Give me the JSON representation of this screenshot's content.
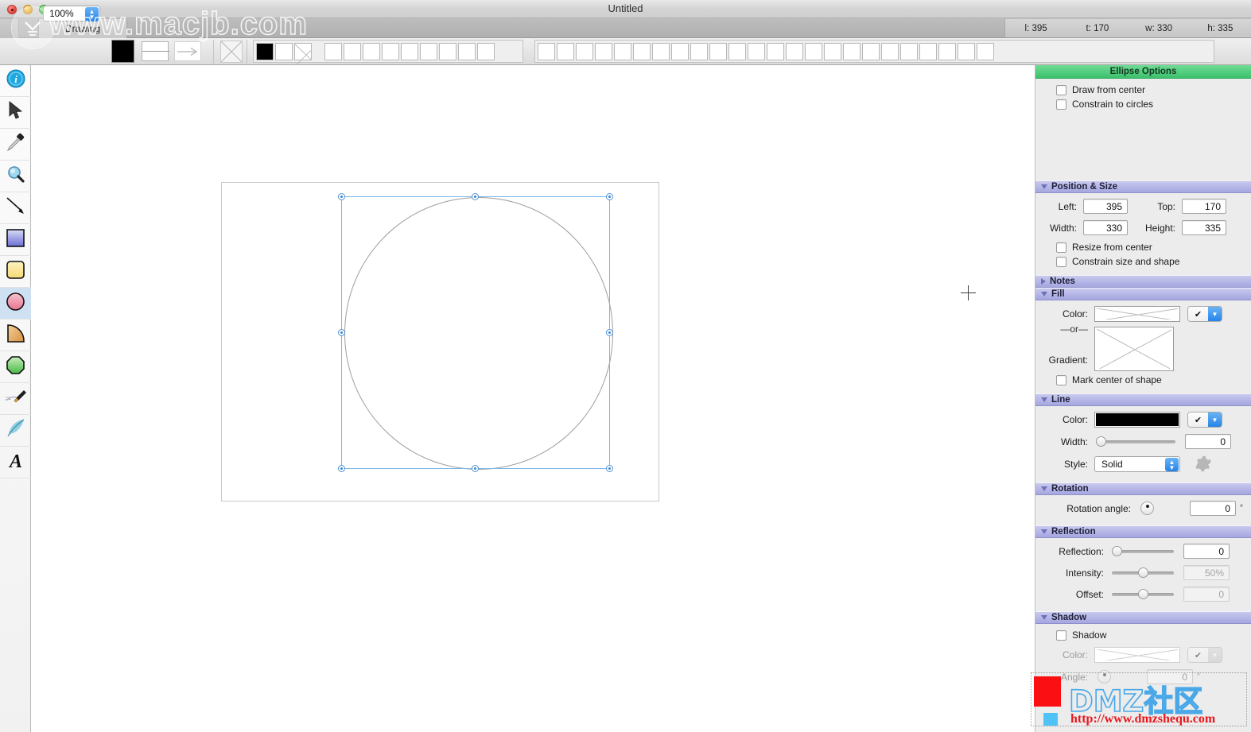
{
  "window": {
    "title": "Untitled",
    "tab_label": "Drawing",
    "traffic_lights": [
      "close-button",
      "minimize-button",
      "zoom-button"
    ]
  },
  "status_bar": {
    "left": "l: 395",
    "top": "t: 170",
    "width": "w: 330",
    "height": "h: 335"
  },
  "toolbar": {
    "zoom_level": "100%",
    "fill_swatch_color": "#000000",
    "line_swatch": "line-style-swatch",
    "arrow_swatch": "arrow-style-swatch",
    "palette_group_1": [
      "black",
      "white",
      "none"
    ],
    "palette_group_1_count": 3,
    "palette_empty_1_count": 9,
    "palette_empty_2_count": 24
  },
  "tools": [
    {
      "name": "info-tool",
      "icon": "info-icon",
      "selected": false
    },
    {
      "name": "selection-tool",
      "icon": "arrow-cursor-icon",
      "selected": false
    },
    {
      "name": "eyedropper-tool",
      "icon": "eyedropper-icon",
      "selected": false
    },
    {
      "name": "zoom-tool",
      "icon": "magnifier-icon",
      "selected": false
    },
    {
      "name": "line-tool",
      "icon": "diagonal-line-icon",
      "selected": false
    },
    {
      "name": "rectangle-tool",
      "icon": "rectangle-icon",
      "selected": false
    },
    {
      "name": "rounded-rectangle-tool",
      "icon": "rounded-rectangle-icon",
      "selected": false
    },
    {
      "name": "ellipse-tool",
      "icon": "ellipse-icon",
      "selected": true
    },
    {
      "name": "arc-tool",
      "icon": "quarter-arc-icon",
      "selected": false
    },
    {
      "name": "polygon-tool",
      "icon": "polygon-icon",
      "selected": false
    },
    {
      "name": "pen-tool",
      "icon": "fountain-pen-icon",
      "selected": false
    },
    {
      "name": "freehand-tool",
      "icon": "feather-quill-icon",
      "selected": false
    },
    {
      "name": "text-tool",
      "icon": "letter-a-icon",
      "selected": false
    }
  ],
  "canvas": {
    "shape": "ellipse",
    "selection_handles": 8,
    "cursor": "crosshair-cursor"
  },
  "inspector": {
    "ellipse_options": {
      "title": "Ellipse Options",
      "draw_from_center": {
        "label": "Draw from center",
        "checked": false
      },
      "constrain_to_circles": {
        "label": "Constrain to circles",
        "checked": false
      }
    },
    "position_size": {
      "title": "Position & Size",
      "expanded": true,
      "left_label": "Left:",
      "left_value": "395",
      "top_label": "Top:",
      "top_value": "170",
      "width_label": "Width:",
      "width_value": "330",
      "height_label": "Height:",
      "height_value": "335",
      "resize_from_center": {
        "label": "Resize from center",
        "checked": false
      },
      "constrain_size_and_shape": {
        "label": "Constrain size and shape",
        "checked": false
      }
    },
    "notes": {
      "title": "Notes",
      "expanded": false
    },
    "fill": {
      "title": "Fill",
      "expanded": true,
      "color_label": "Color:",
      "color_value": "none",
      "or_label": "—or—",
      "gradient_label": "Gradient:",
      "gradient_value": "none",
      "mark_center": {
        "label": "Mark center of shape",
        "checked": false
      },
      "apply_button": "✔"
    },
    "line": {
      "title": "Line",
      "expanded": true,
      "color_label": "Color:",
      "color_value": "#000000",
      "width_label": "Width:",
      "width_value": "0",
      "style_label": "Style:",
      "style_value": "Solid",
      "settings_icon": "gear-icon",
      "apply_button": "✔"
    },
    "rotation": {
      "title": "Rotation",
      "expanded": true,
      "angle_label": "Rotation angle:",
      "angle_value": "0",
      "degree_symbol": "°"
    },
    "reflection": {
      "title": "Reflection",
      "expanded": true,
      "reflection_label": "Reflection:",
      "reflection_value": "0",
      "intensity_label": "Intensity:",
      "intensity_value": "50%",
      "offset_label": "Offset:",
      "offset_value": "0"
    },
    "shadow": {
      "title": "Shadow",
      "expanded": true,
      "shadow_checkbox": {
        "label": "Shadow",
        "checked": false
      },
      "color_label": "Color:",
      "angle_label": "Angle:",
      "angle_value": "0",
      "degree_symbol": "°"
    }
  },
  "watermarks": {
    "top_left": "www.macjb.com",
    "bottom_right_brand": "DMZ社区",
    "bottom_right_url": "http://www.dmzshequ.com"
  },
  "colors": {
    "accent_blue": "#2684e8",
    "panel_header": "#a4a6e0",
    "green_header": "#3cc06d",
    "selection_blue": "#7ab5e8",
    "watermark_red": "#e8171c"
  }
}
